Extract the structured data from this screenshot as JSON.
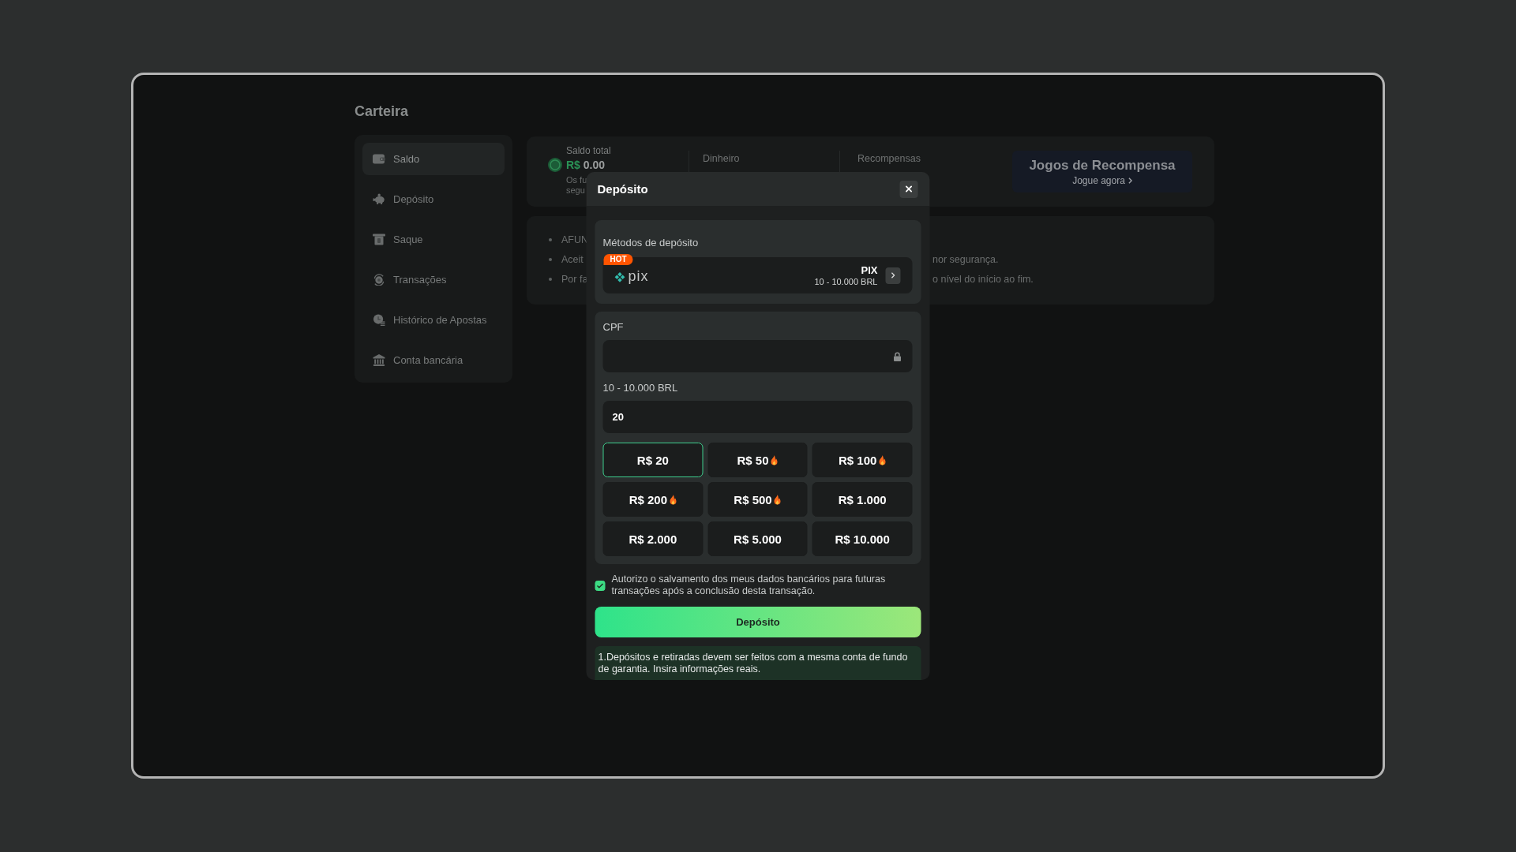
{
  "page": {
    "title": "Carteira"
  },
  "sidebar": {
    "items": [
      {
        "label": "Saldo",
        "selected": true
      },
      {
        "label": "Depósito",
        "selected": false
      },
      {
        "label": "Saque",
        "selected": false
      },
      {
        "label": "Transações",
        "selected": false
      },
      {
        "label": "Histórico de Apostas",
        "selected": false
      },
      {
        "label": "Conta bancária",
        "selected": false
      }
    ]
  },
  "balance_card": {
    "label": "Saldo total",
    "currency": "R$",
    "amount": "0.00",
    "note_lines": [
      "Os fu",
      "segu"
    ],
    "columns": [
      {
        "label": "Dinheiro"
      },
      {
        "label": "Recompensas"
      }
    ],
    "rewards_button": {
      "title": "Jogos de Recompensa",
      "link": "Jogue agora"
    }
  },
  "notices": [
    {
      "left": "AFUN"
    },
    {
      "left": "Aceit",
      "right": "nor segurança."
    },
    {
      "left": "Por fa",
      "right": "o nível do início ao fim."
    }
  ],
  "modal": {
    "title": "Depósito",
    "methods": {
      "label": "Métodos de depósito",
      "items": [
        {
          "badge": "HOT",
          "logo_text": "pix",
          "name": "PIX",
          "range": "10 - 10.000 BRL"
        }
      ]
    },
    "cpf": {
      "label": "CPF"
    },
    "amount": {
      "label": "10 - 10.000 BRL",
      "value": "20",
      "presets": [
        {
          "label": "R$ 20",
          "selected": true,
          "hot": false
        },
        {
          "label": "R$ 50",
          "selected": false,
          "hot": true
        },
        {
          "label": "R$ 100",
          "selected": false,
          "hot": true
        },
        {
          "label": "R$ 200",
          "selected": false,
          "hot": true
        },
        {
          "label": "R$ 500",
          "selected": false,
          "hot": true
        },
        {
          "label": "R$ 1.000",
          "selected": false,
          "hot": false
        },
        {
          "label": "R$ 2.000",
          "selected": false,
          "hot": false
        },
        {
          "label": "R$ 5.000",
          "selected": false,
          "hot": false
        },
        {
          "label": "R$ 10.000",
          "selected": false,
          "hot": false
        }
      ]
    },
    "consent": {
      "checked": true,
      "text": "Autorizo o salvamento dos meus dados bancários para futuras transações após a conclusão desta transação."
    },
    "submit": {
      "label": "Depósito"
    },
    "notice": "1.Depósitos e retiradas devem ser feitos com a mesma conta de fundo de garantia. Insira informações reais."
  }
}
